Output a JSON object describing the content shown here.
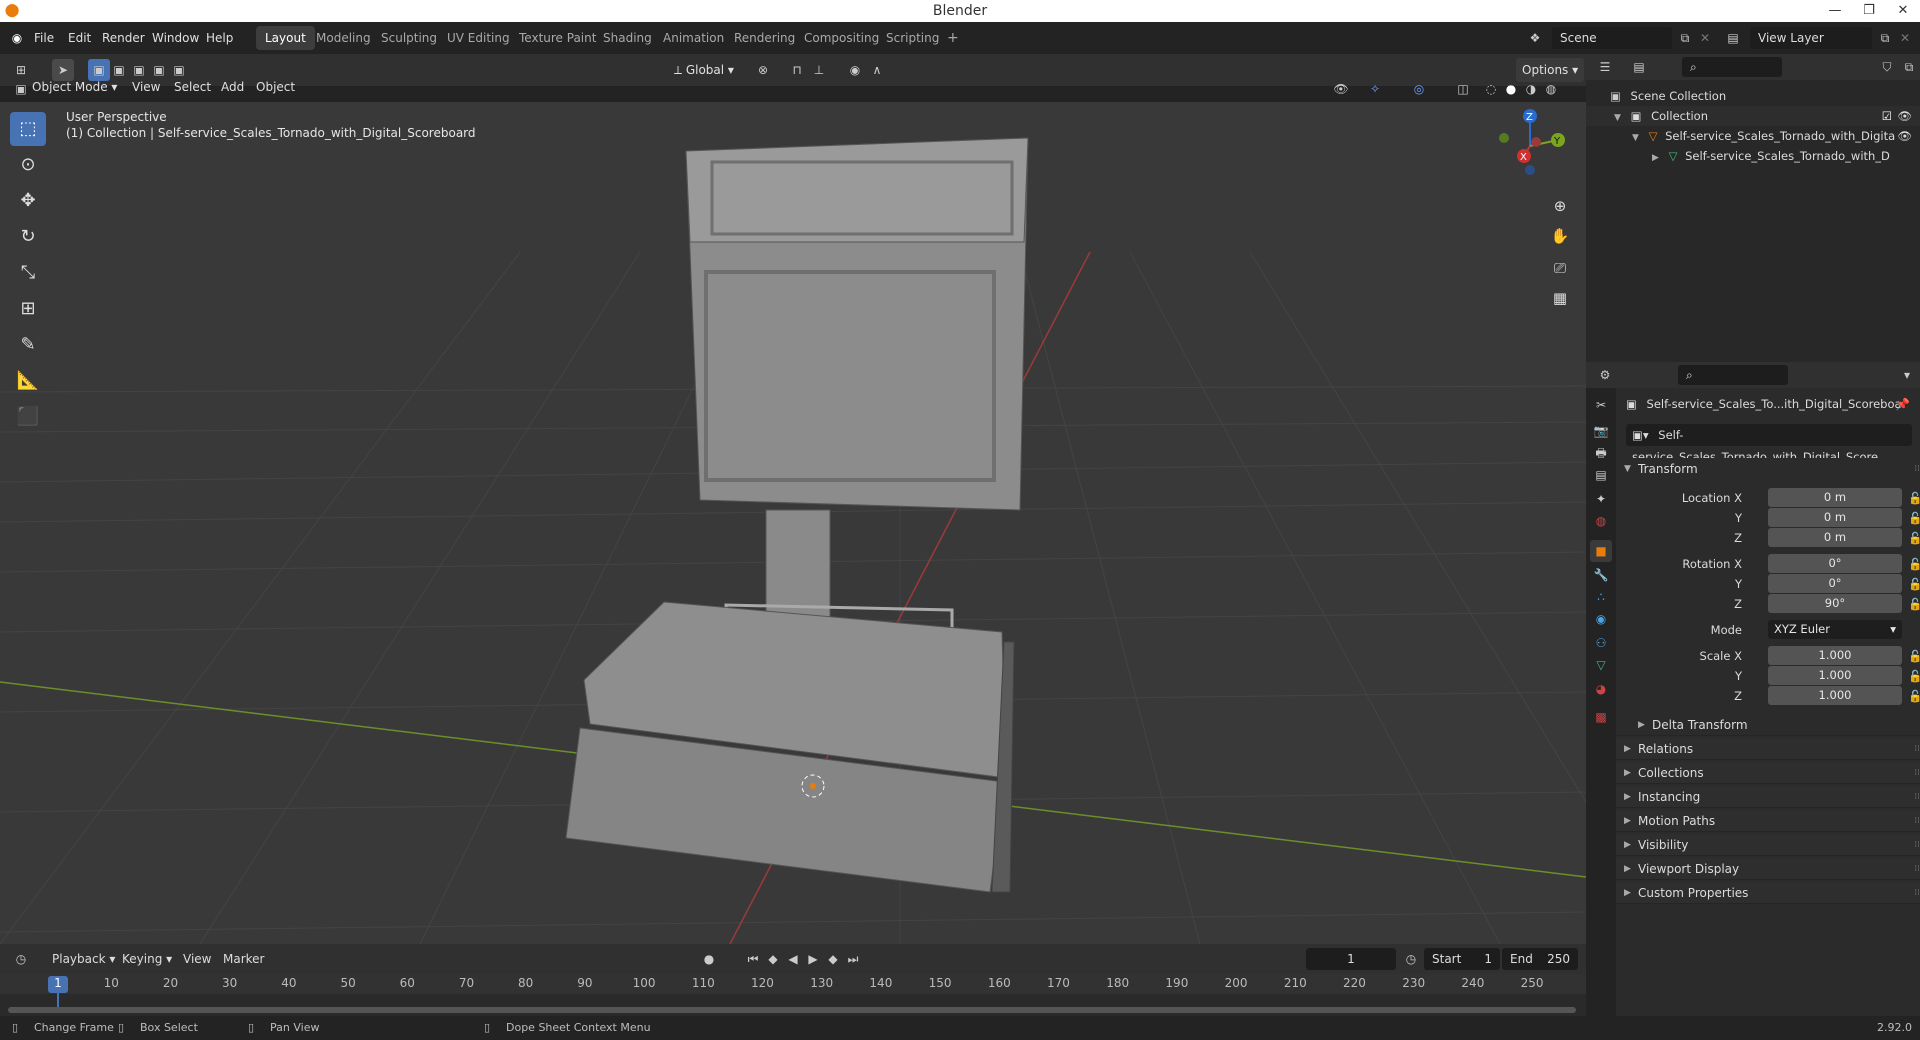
{
  "window": {
    "title": "Blender",
    "min": "—",
    "max": "❐",
    "close": "✕"
  },
  "menu": [
    "File",
    "Edit",
    "Render",
    "Window",
    "Help"
  ],
  "workspaces": [
    "Layout",
    "Modeling",
    "Sculpting",
    "UV Editing",
    "Texture Paint",
    "Shading",
    "Animation",
    "Rendering",
    "Compositing",
    "Scripting"
  ],
  "workspace_add": "+",
  "scene": {
    "label": "Scene"
  },
  "view_layer": {
    "label": "View Layer"
  },
  "viewport_header": {
    "mode": "Object Mode",
    "menus": [
      "View",
      "Select",
      "Add",
      "Object"
    ],
    "transform_orientation": "Global",
    "options": "Options"
  },
  "viewport": {
    "perspective": "User Perspective",
    "collection_info": "(1) Collection | Self-service_Scales_Tornado_with_Digital_Scoreboard",
    "gizmo": {
      "z": "Z",
      "y": "Y",
      "x": "X"
    }
  },
  "outliner": {
    "scene_collection": "Scene Collection",
    "collection": "Collection",
    "object": "Self-service_Scales_Tornado_with_Digita",
    "mesh": "Self-service_Scales_Tornado_with_D"
  },
  "properties": {
    "object_name": "Self-service_Scales_To...ith_Digital_Scoreboar",
    "object_field": "Self-service_Scales_Tornado_with_Digital_Score...",
    "transform_title": "Transform",
    "location": {
      "label": "Location X",
      "y_label": "Y",
      "z_label": "Z",
      "x": "0 m",
      "y": "0 m",
      "z": "0 m"
    },
    "rotation": {
      "label": "Rotation X",
      "y_label": "Y",
      "z_label": "Z",
      "x": "0°",
      "y": "0°",
      "z": "90°"
    },
    "mode": {
      "label": "Mode",
      "value": "XYZ Euler"
    },
    "scale": {
      "label": "Scale X",
      "y_label": "Y",
      "z_label": "Z",
      "x": "1.000",
      "y": "1.000",
      "z": "1.000"
    },
    "delta_transform": "Delta Transform",
    "panels": [
      "Relations",
      "Collections",
      "Instancing",
      "Motion Paths",
      "Visibility",
      "Viewport Display",
      "Custom Properties"
    ]
  },
  "timeline": {
    "menus": [
      "Playback",
      "Keying",
      "View",
      "Marker"
    ],
    "current_frame": "1",
    "start_label": "Start",
    "start": "1",
    "end_label": "End",
    "end": "250",
    "ticks": [
      "1",
      "10",
      "20",
      "30",
      "40",
      "50",
      "60",
      "70",
      "80",
      "90",
      "100",
      "110",
      "120",
      "130",
      "140",
      "150",
      "160",
      "170",
      "180",
      "190",
      "200",
      "210",
      "220",
      "230",
      "240",
      "250"
    ]
  },
  "statusbar": {
    "change_frame": "Change Frame",
    "box_select": "Box Select",
    "pan_view": "Pan View",
    "context_menu": "Dope Sheet Context Menu",
    "version": "2.92.0"
  },
  "colors": {
    "accent": "#4772b3",
    "header": "#303030",
    "object_orange": "#e87d0d"
  }
}
